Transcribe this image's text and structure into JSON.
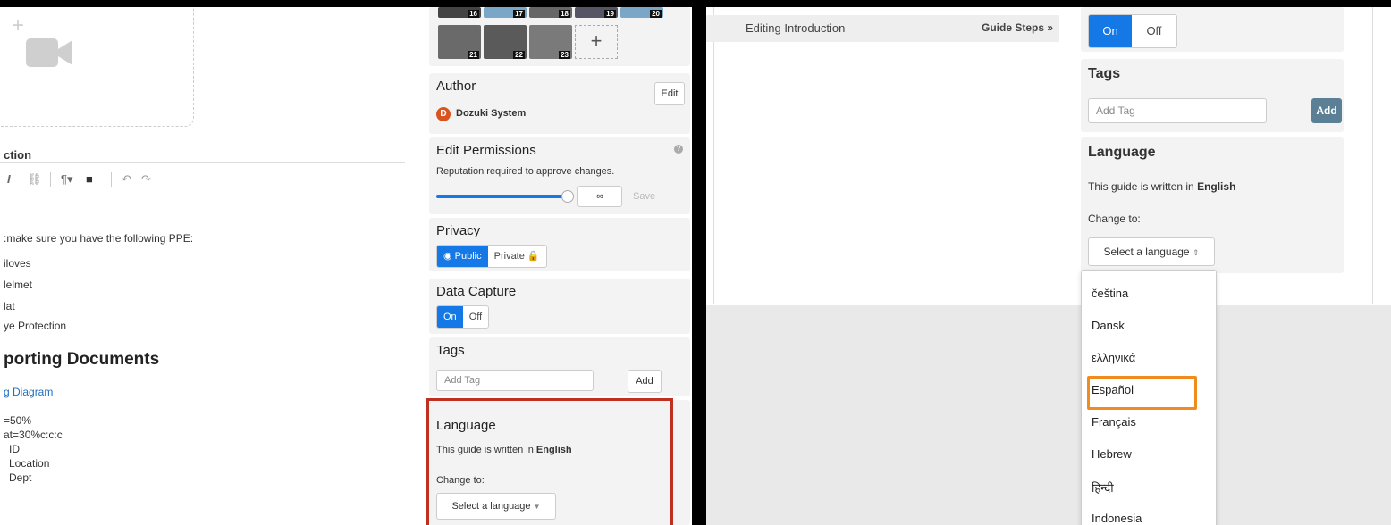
{
  "left": {
    "section_label": "ction",
    "body_lines": [
      ":make sure you have the following PPE:",
      "iloves",
      "lelmet",
      "lat",
      "ye Protection"
    ],
    "doc_heading": "porting Documents",
    "doc_link": "g Diagram",
    "meta_lines": [
      "=50%",
      "at=30%c:c:c",
      "ID",
      "Location",
      "Dept"
    ],
    "toolbar_icons": [
      "italic-icon",
      "link-icon",
      "paragraph-icon",
      "video-icon",
      "undo-icon",
      "redo-icon"
    ],
    "thumbnails": [
      "16",
      "17",
      "18",
      "19",
      "20",
      "21",
      "22",
      "23"
    ],
    "add_thumb": "+",
    "author": {
      "title": "Author",
      "edit": "Edit",
      "name": "Dozuki System",
      "initial": "D"
    },
    "permissions": {
      "title": "Edit Permissions",
      "desc": "Reputation required to approve changes.",
      "value": "∞",
      "save": "Save",
      "slider_level": 0.97
    },
    "privacy": {
      "title": "Privacy",
      "public": "Public",
      "private": "Private"
    },
    "data_capture": {
      "title": "Data Capture",
      "on": "On",
      "off": "Off"
    },
    "tags": {
      "title": "Tags",
      "placeholder": "Add Tag",
      "add": "Add"
    },
    "language": {
      "title": "Language",
      "written_prefix": "This guide is written in ",
      "written_lang": "English",
      "change_to": "Change to:",
      "select": "Select a language"
    }
  },
  "right": {
    "header_title": "Editing Introduction",
    "header_link": "Guide Steps »",
    "toggle": {
      "on": "On",
      "off": "Off"
    },
    "tags": {
      "title": "Tags",
      "placeholder": "Add Tag",
      "add": "Add"
    },
    "language": {
      "title": "Language",
      "written_prefix": "This guide is written in ",
      "written_lang": "English",
      "change_to": "Change to:",
      "select": "Select a language"
    },
    "options": [
      "čeština",
      "Dansk",
      "ελληνικά",
      "Español",
      "Français",
      "Hebrew",
      "हिन्दी",
      "Indonesia"
    ],
    "highlighted_option": "Español"
  },
  "colors": {
    "accent": "#1478e6",
    "red_highlight": "#c03020",
    "orange_highlight": "#f08c1e",
    "add_button": "#5b7f95",
    "author_icon": "#d9531e"
  }
}
